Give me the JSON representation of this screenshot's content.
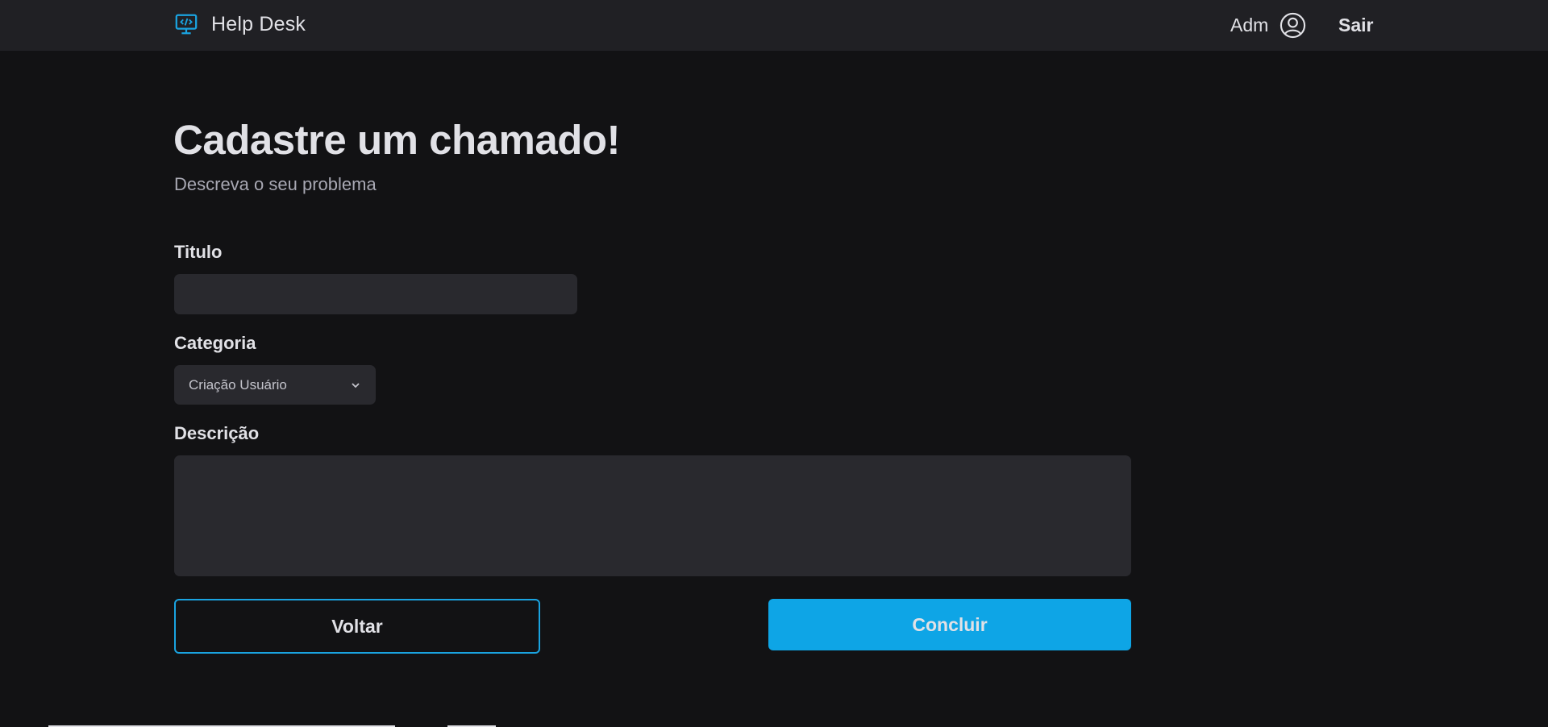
{
  "header": {
    "brand": "Help Desk",
    "brand_icon": "monitor-code-icon",
    "user_name": "Adm",
    "user_icon": "user-circle-icon",
    "logout_label": "Sair",
    "accent_color": "#1aa3e0"
  },
  "main": {
    "title": "Cadastre um chamado!",
    "subtitle": "Descreva o seu problema"
  },
  "form": {
    "title_label": "Titulo",
    "title_value": "",
    "category_label": "Categoria",
    "category_selected": "Criação Usuário",
    "description_label": "Descrição",
    "description_value": ""
  },
  "actions": {
    "back_label": "Voltar",
    "done_label": "Concluir"
  }
}
